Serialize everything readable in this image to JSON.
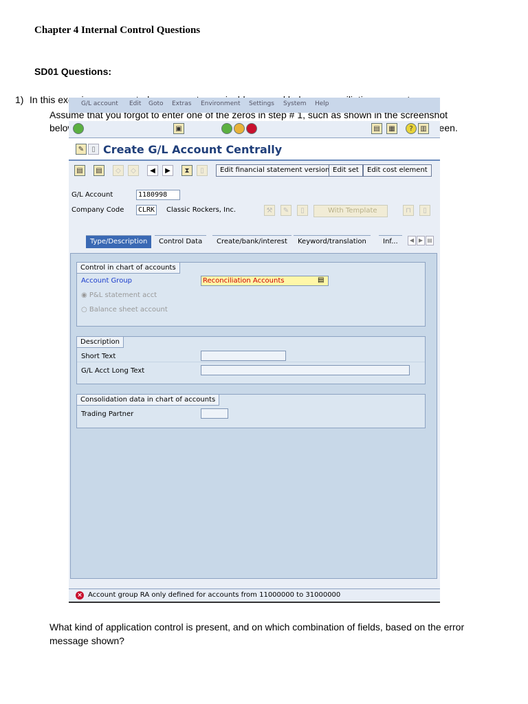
{
  "document": {
    "title": "Chapter 4 Internal Control Questions",
    "section": "SD01 Questions:",
    "question1": {
      "number": "1)",
      "line1": "In this exercise, you created an accounts receivable general ledger reconciliation account.",
      "continuation": "Assume that you forgot to enter one of the zeros in step # 1, such as shown in the screenshot below. Upon performing step #3, an error message would be shown at the bottom of the screen."
    },
    "question2": "What kind of application control is present, and on which combination of fields, based on the error message shown?"
  },
  "sap": {
    "menu": [
      "G/L account",
      "Edit",
      "Goto",
      "Extras",
      "Environment",
      "Settings",
      "System",
      "Help"
    ],
    "screen_title": "Create G/L Account Centrally",
    "app_buttons": [
      "Edit financial statement version",
      "Edit set",
      "Edit cost element"
    ],
    "header": {
      "gl_account_label": "G/L Account",
      "gl_account_value": "1180998",
      "company_code_label": "Company Code",
      "company_code_value": "CLRK",
      "company_name": "Classic Rockers, Inc.",
      "template_button": "With Template"
    },
    "tabs": [
      "Type/Description",
      "Control Data",
      "Create/bank/interest",
      "Keyword/translation",
      "Inf..."
    ],
    "control_group": {
      "title": "Control in chart of accounts",
      "account_group_label": "Account Group",
      "account_group_value": "Reconciliation Accounts",
      "radio_pl": "P&L statement acct",
      "radio_bs": "Balance sheet account"
    },
    "description_group": {
      "title": "Description",
      "short_text_label": "Short Text",
      "long_text_label": "G/L Acct Long Text"
    },
    "consolidation_group": {
      "title": "Consolidation data in chart of accounts",
      "trading_partner_label": "Trading Partner"
    },
    "status_message": "Account group RA only defined for accounts from 11000000 to 31000000"
  }
}
